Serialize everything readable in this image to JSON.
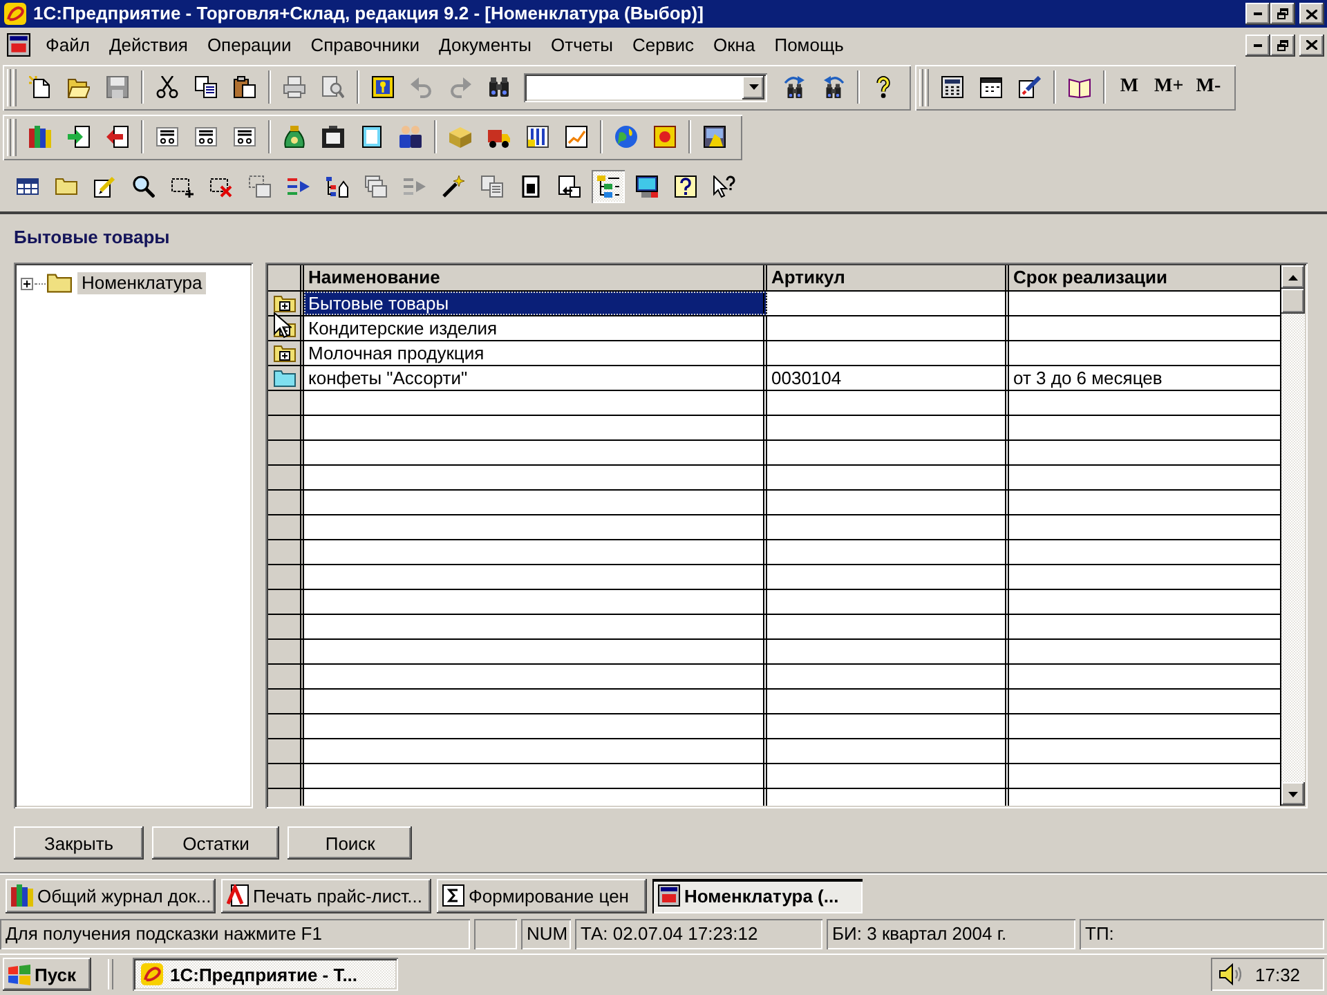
{
  "window": {
    "title": "1С:Предприятие - Торговля+Склад, редакция 9.2 - [Номенклатура (Выбор)]"
  },
  "menu": [
    "Файл",
    "Действия",
    "Операции",
    "Справочники",
    "Документы",
    "Отчеты",
    "Сервис",
    "Окна",
    "Помощь"
  ],
  "toolbar_rows": [
    [
      {
        "groups": [
          [
            {
              "kind": "button",
              "disabled": false
            },
            {
              "kind": "button",
              "disabled": false
            },
            {
              "kind": "button",
              "disabled": true
            }
          ],
          [
            {
              "kind": "button",
              "disabled": false
            },
            {
              "kind": "button",
              "disabled": false
            },
            {
              "kind": "button",
              "disabled": false
            }
          ],
          [
            {
              "kind": "button",
              "disabled": true
            },
            {
              "kind": "button",
              "disabled": true
            }
          ],
          [
            {
              "kind": "button",
              "disabled": false
            },
            {
              "kind": "button",
              "disabled": true
            },
            {
              "kind": "button",
              "disabled": true
            },
            {
              "kind": "button",
              "disabled": false
            },
            {
              "kind": "combo"
            },
            {
              "kind": "button",
              "disabled": false
            },
            {
              "kind": "button",
              "disabled": false
            }
          ],
          [
            {
              "kind": "button",
              "disabled": false
            }
          ]
        ]
      },
      {
        "groups": [
          [
            {
              "kind": "button",
              "disabled": false
            },
            {
              "kind": "button",
              "disabled": false
            },
            {
              "kind": "button",
              "disabled": false
            }
          ],
          [
            {
              "kind": "button",
              "disabled": false
            }
          ],
          [
            {
              "kind": "text",
              "label": "M"
            },
            {
              "kind": "text",
              "label": "M+"
            },
            {
              "kind": "text",
              "label": "M-"
            }
          ]
        ]
      }
    ],
    [
      {
        "groups": [
          [
            {
              "kind": "button",
              "disabled": false
            },
            {
              "kind": "button",
              "disabled": false
            },
            {
              "kind": "button",
              "disabled": false
            }
          ],
          [
            {
              "kind": "button",
              "disabled": false
            },
            {
              "kind": "button",
              "disabled": false
            },
            {
              "kind": "button",
              "disabled": false
            }
          ],
          [
            {
              "kind": "button",
              "disabled": false
            },
            {
              "kind": "button",
              "disabled": false
            },
            {
              "kind": "button",
              "disabled": false
            },
            {
              "kind": "button",
              "disabled": false
            }
          ],
          [
            {
              "kind": "button",
              "disabled": false
            },
            {
              "kind": "button",
              "disabled": false
            },
            {
              "kind": "button",
              "disabled": false
            },
            {
              "kind": "button",
              "disabled": false
            }
          ],
          [
            {
              "kind": "button",
              "disabled": false
            },
            {
              "kind": "button",
              "disabled": false
            }
          ],
          [
            {
              "kind": "button",
              "disabled": false
            }
          ]
        ]
      }
    ]
  ],
  "form_toolbar": {
    "items": [
      {
        "kind": "button",
        "disabled": false,
        "pressed": false
      },
      {
        "kind": "button",
        "disabled": false,
        "pressed": false
      },
      {
        "kind": "button",
        "disabled": false,
        "pressed": false
      },
      {
        "kind": "button",
        "disabled": false,
        "pressed": false
      },
      {
        "kind": "button",
        "disabled": false,
        "pressed": false
      },
      {
        "kind": "button",
        "disabled": false,
        "pressed": false
      },
      {
        "kind": "button",
        "disabled": true,
        "pressed": false
      },
      {
        "kind": "button",
        "disabled": false,
        "pressed": false
      },
      {
        "kind": "button",
        "disabled": false,
        "pressed": false
      },
      {
        "kind": "button",
        "disabled": true,
        "pressed": false
      },
      {
        "kind": "button",
        "disabled": true,
        "pressed": false
      },
      {
        "kind": "button",
        "disabled": false,
        "pressed": false
      },
      {
        "kind": "button",
        "disabled": true,
        "pressed": false
      },
      {
        "kind": "button",
        "disabled": false,
        "pressed": false
      },
      {
        "kind": "button",
        "disabled": false,
        "pressed": false
      },
      {
        "kind": "button",
        "disabled": false,
        "pressed": true
      },
      {
        "kind": "button",
        "disabled": false,
        "pressed": false
      },
      {
        "kind": "button",
        "disabled": false,
        "pressed": false
      },
      {
        "kind": "button",
        "disabled": false,
        "pressed": false
      }
    ]
  },
  "form": {
    "heading": "Бытовые товары",
    "tree": [
      {
        "label": "Номенклатура",
        "expanded": false,
        "selected": true
      }
    ],
    "table": {
      "columns": [
        "Наименование",
        "Артикул",
        "Срок реализации"
      ],
      "rows": [
        {
          "kind": "group",
          "selected": true,
          "cells": [
            "Бытовые товары"
          ]
        },
        {
          "kind": "group",
          "selected": false,
          "cells": [
            "Кондитерские изделия"
          ]
        },
        {
          "kind": "group",
          "selected": false,
          "cells": [
            "Молочная продукция"
          ]
        },
        {
          "kind": "item",
          "selected": false,
          "cells": [
            "конфеты \"Ассорти\"",
            "0030104",
            "от 3 до 6 месяцев"
          ]
        }
      ]
    },
    "buttons": [
      "Закрыть",
      "Остатки",
      "Поиск"
    ]
  },
  "window_tabs": [
    {
      "label": "Общий журнал док...",
      "selected": false
    },
    {
      "label": "Печать прайс-лист...",
      "selected": false
    },
    {
      "label": "Формирование цен",
      "selected": false
    },
    {
      "label": "Номенклатура (...",
      "selected": true
    }
  ],
  "status_bar": {
    "hint": "Для получения подсказки нажмите F1",
    "panels": [
      "NUM",
      "ТА: 02.07.04 17:23:12",
      "БИ: 3 квартал 2004 г.",
      "ТП:"
    ]
  },
  "taskbar": {
    "start": "Пуск",
    "tasks": [
      {
        "label": "1С:Предприятие - Т...",
        "selected": true
      }
    ],
    "clock": "17:32"
  }
}
